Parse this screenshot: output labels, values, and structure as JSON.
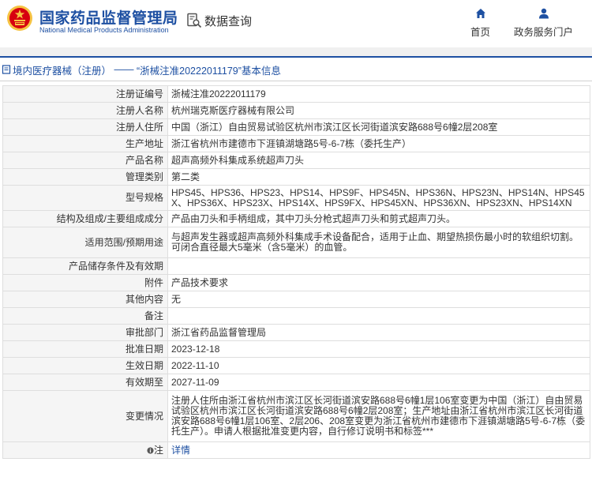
{
  "header": {
    "org_name_cn": "国家药品监督管理局",
    "org_name_en": "National Medical Products Administration",
    "search_label": "数据查询",
    "nav": {
      "home": "首页",
      "gov_portal": "政务服务门户"
    }
  },
  "breadcrumb": {
    "category": "境内医疗器械（注册）",
    "separator": " —— ",
    "title": "“浙械注准20222011179”基本信息"
  },
  "details": [
    {
      "label": "注册证编号",
      "value": "浙械注准20222011179"
    },
    {
      "label": "注册人名称",
      "value": "杭州瑞克斯医疗器械有限公司"
    },
    {
      "label": "注册人住所",
      "value": "中国（浙江）自由贸易试验区杭州市滨江区长河街道滨安路688号6幢2层208室"
    },
    {
      "label": "生产地址",
      "value": "浙江省杭州市建德市下涯镇湖塘路5号-6-7栋（委托生产）"
    },
    {
      "label": "产品名称",
      "value": "超声高频外科集成系统超声刀头"
    },
    {
      "label": "管理类别",
      "value": "第二类"
    },
    {
      "label": "型号规格",
      "value": "HPS45、HPS36、HPS23、HPS14、HPS9F、HPS45N、HPS36N、HPS23N、HPS14N、HPS45X、HPS36X、HPS23X、HPS14X、HPS9FX、HPS45XN、HPS36XN、HPS23XN、HPS14XN"
    },
    {
      "label": "结构及组成/主要组成成分",
      "value": "产品由刀头和手柄组成，其中刀头分枪式超声刀头和剪式超声刀头。"
    },
    {
      "label": "适用范围/预期用途",
      "value": "与超声发生器或超声高频外科集成手术设备配合，适用于止血、期望热损伤最小时的软组织切割。可闭合直径最大5毫米（含5毫米）的血管。"
    },
    {
      "label": "产品储存条件及有效期",
      "value": ""
    },
    {
      "label": "附件",
      "value": "产品技术要求"
    },
    {
      "label": "其他内容",
      "value": "无"
    },
    {
      "label": "备注",
      "value": ""
    },
    {
      "label": "审批部门",
      "value": "浙江省药品监督管理局"
    },
    {
      "label": "批准日期",
      "value": "2023-12-18"
    },
    {
      "label": "生效日期",
      "value": "2022-11-10"
    },
    {
      "label": "有效期至",
      "value": "2027-11-09"
    },
    {
      "label": "变更情况",
      "value": "注册人住所由浙江省杭州市滨江区长河街道滨安路688号6幢1层106室变更为中国（浙江）自由贸易试验区杭州市滨江区长河街道滨安路688号6幢2层208室；生产地址由浙江省杭州市滨江区长河街道滨安路688号6幢1层106室、2层206、208室变更为浙江省杭州市建德市下涯镇湖塘路5号-6-7栋（委托生产）。申请人根据批准变更内容，自行修订说明书和标签***"
    }
  ],
  "note_row": {
    "label": "注",
    "link_text": "详情"
  },
  "colors": {
    "brand_blue": "#1e50a2",
    "emblem_red": "#d7000f",
    "emblem_gold": "#f6c343"
  },
  "icons": {
    "emblem": "national-emblem-icon",
    "search": "search-document-icon",
    "home": "home-icon",
    "user": "user-icon",
    "breadcrumb": "document-icon",
    "note": "info-icon"
  }
}
